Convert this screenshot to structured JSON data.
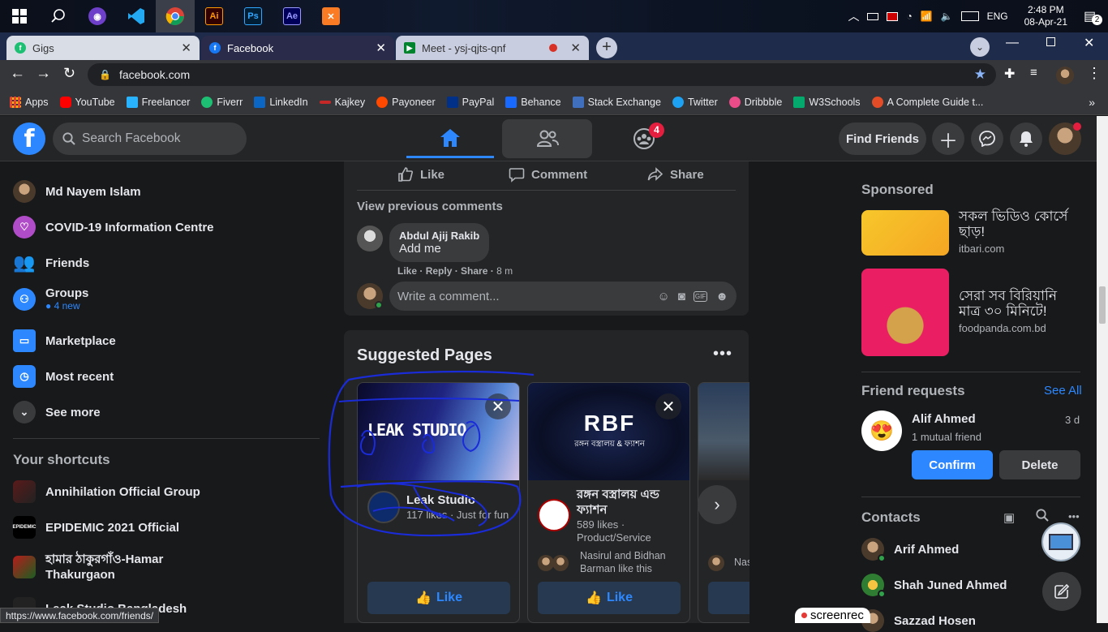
{
  "taskbar": {
    "apps": [
      {
        "name": "windows-start-icon"
      },
      {
        "name": "search-icon"
      },
      {
        "name": "github-desktop-icon"
      },
      {
        "name": "vscode-icon"
      },
      {
        "name": "chrome-icon"
      },
      {
        "name": "illustrator-icon",
        "label": "Ai"
      },
      {
        "name": "photoshop-icon",
        "label": "Ps"
      },
      {
        "name": "after-effects-icon",
        "label": "Ae"
      },
      {
        "name": "xampp-icon"
      }
    ],
    "lang": "ENG",
    "time": "2:48 PM",
    "date": "08-Apr-21",
    "notif_count": "2"
  },
  "browser": {
    "tabs": [
      {
        "title": "Gigs",
        "active": false
      },
      {
        "title": "Facebook",
        "active": true
      },
      {
        "title": "Meet - ysj-qjts-qnf",
        "active": false
      }
    ],
    "url": "facebook.com",
    "bookmarks": [
      "Apps",
      "YouTube",
      "Freelancer",
      "Fiverr",
      "LinkedIn",
      "Kajkey",
      "Payoneer",
      "PayPal",
      "Behance",
      "Stack Exchange",
      "Twitter",
      "Dribbble",
      "W3Schools",
      "A Complete Guide t..."
    ],
    "status_url": "https://www.facebook.com/friends/"
  },
  "header": {
    "search_placeholder": "Search Facebook",
    "groups_badge": "4",
    "find_friends": "Find Friends"
  },
  "sidebar": {
    "items": [
      {
        "label": "Md Nayem Islam"
      },
      {
        "label": "COVID-19 Information Centre"
      },
      {
        "label": "Friends"
      },
      {
        "label": "Groups",
        "sub": "4 new"
      },
      {
        "label": "Marketplace"
      },
      {
        "label": "Most recent"
      },
      {
        "label": "See more"
      }
    ],
    "shortcuts_title": "Your shortcuts",
    "shortcuts": [
      {
        "label": "Annihilation Official Group"
      },
      {
        "label": "EPIDEMIC 2021 Official"
      },
      {
        "label": "হামার ঠাকুরগাঁও-Hamar Thakurgaon"
      },
      {
        "label": "Leak Studio Bangladesh"
      }
    ]
  },
  "post": {
    "actions": {
      "like": "Like",
      "comment": "Comment",
      "share": "Share"
    },
    "view_previous": "View previous comments",
    "comment": {
      "author": "Abdul Ajij Rakib",
      "text": "Add me",
      "like": "Like",
      "reply": "Reply",
      "share": "Share",
      "time": "8 m"
    },
    "write_placeholder": "Write a comment..."
  },
  "suggested": {
    "title": "Suggested Pages",
    "pages": [
      {
        "cover_text": "LEAK STUDIO",
        "name": "Leak Studio",
        "meta": "117 likes · Just for fun",
        "like": "Like"
      },
      {
        "cover_text": "RBF",
        "cover_sub": "রঙ্গন বস্ত্রালয় & ফ্যাশন",
        "name": "রঙ্গন বস্ত্রালয় এন্ড ফ্যাশন",
        "meta": "589 likes ·",
        "meta2": "Product/Service",
        "mutual": "Nasirul and Bidhan Barman like this",
        "like": "Like"
      },
      {
        "name": "",
        "mutual": "Nas",
        "like": ""
      }
    ]
  },
  "right": {
    "sponsored_title": "Sponsored",
    "ads": [
      {
        "title": "সকল ভিডিও কোর্সে ছাড়!",
        "domain": "itbari.com"
      },
      {
        "title": "সেরা সব বিরিয়ানি মাত্র ৩০ মিনিটে!",
        "domain": "foodpanda.com.bd"
      }
    ],
    "friend_requests_title": "Friend requests",
    "see_all": "See All",
    "request": {
      "name": "Alif Ahmed",
      "time": "3 d",
      "mutual": "1 mutual friend",
      "confirm": "Confirm",
      "delete": "Delete"
    },
    "contacts_title": "Contacts",
    "contacts": [
      {
        "name": "Arif Ahmed"
      },
      {
        "name": "Shah Juned Ahmed"
      },
      {
        "name": "Sazzad Hosen"
      }
    ]
  },
  "overlay": {
    "screenrec": "screenrec"
  },
  "colors": {
    "accent": "#2d88ff",
    "bg": "#18191a",
    "surface": "#242526",
    "badge": "#e41e3f"
  }
}
